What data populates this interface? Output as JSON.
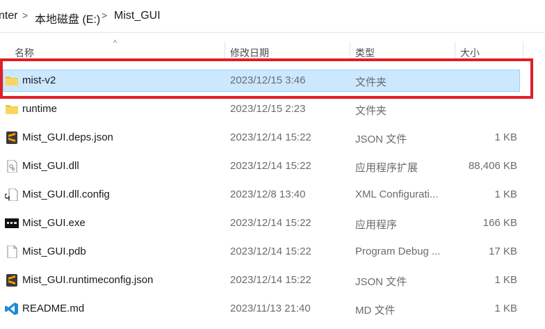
{
  "breadcrumb": {
    "items": [
      "nter",
      "本地磁盘 (E:)",
      "Mist_GUI"
    ],
    "separator": ">"
  },
  "columns": {
    "name": "名称",
    "date": "修改日期",
    "type": "类型",
    "size": "大小",
    "sort_indicator": "^"
  },
  "files": [
    {
      "name": "mist-v2",
      "date": "2023/12/15 3:46",
      "type": "文件夹",
      "size": "",
      "icon": "folder-icon",
      "selected": true
    },
    {
      "name": "runtime",
      "date": "2023/12/15 2:23",
      "type": "文件夹",
      "size": "",
      "icon": "folder-icon",
      "selected": false
    },
    {
      "name": "Mist_GUI.deps.json",
      "date": "2023/12/14 15:22",
      "type": "JSON 文件",
      "size": "1 KB",
      "icon": "sublime-text-icon",
      "selected": false
    },
    {
      "name": "Mist_GUI.dll",
      "date": "2023/12/14 15:22",
      "type": "应用程序扩展",
      "size": "88,406 KB",
      "icon": "dll-file-icon",
      "selected": false
    },
    {
      "name": "Mist_GUI.dll.config",
      "date": "2023/12/8 13:40",
      "type": "XML Configurati...",
      "size": "1 KB",
      "icon": "config-file-icon",
      "selected": false
    },
    {
      "name": "Mist_GUI.exe",
      "date": "2023/12/14 15:22",
      "type": "应用程序",
      "size": "166 KB",
      "icon": "exe-app-icon",
      "selected": false
    },
    {
      "name": "Mist_GUI.pdb",
      "date": "2023/12/14 15:22",
      "type": "Program Debug ...",
      "size": "17 KB",
      "icon": "blank-file-icon",
      "selected": false
    },
    {
      "name": "Mist_GUI.runtimeconfig.json",
      "date": "2023/12/14 15:22",
      "type": "JSON 文件",
      "size": "1 KB",
      "icon": "sublime-text-icon",
      "selected": false
    },
    {
      "name": "README.md",
      "date": "2023/11/13 21:40",
      "type": "MD 文件",
      "size": "1 KB",
      "icon": "vscode-icon",
      "selected": false
    }
  ],
  "colors": {
    "selection_bg": "#cce8ff",
    "selection_border": "#99d1ff",
    "highlight_box": "#e01f26",
    "folder": "#f5c342"
  }
}
